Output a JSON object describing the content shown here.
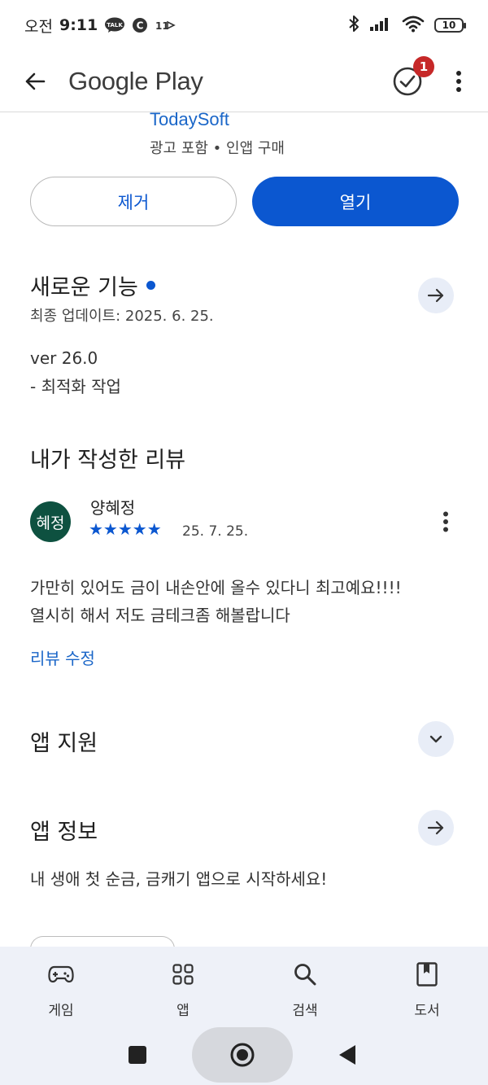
{
  "status_bar": {
    "time_prefix": "오전",
    "time": "9:11",
    "notif_talk": "TALK",
    "notif_c": "C",
    "notif_11": "11",
    "battery": "10"
  },
  "app_bar": {
    "title": "Google Play",
    "badge_count": "1"
  },
  "app": {
    "developer": "TodaySoft",
    "meta": "광고 포함 • 인앱 구매"
  },
  "actions": {
    "uninstall_label": "제거",
    "open_label": "열기"
  },
  "whats_new": {
    "title": "새로운 기능",
    "last_updated": "최종 업데이트: 2025. 6. 25.",
    "version": "ver 26.0",
    "notes": "- 최적화 작업"
  },
  "my_review": {
    "title": "내가 작성한 리뷰",
    "avatar_text": "혜정",
    "reviewer": "양혜정",
    "stars": "★★★★★",
    "rating": 5,
    "date": "25. 7. 25.",
    "text_line1": "가만히 있어도 금이 내손안에 올수 있다니 최고예요!!!!",
    "text_line2": "열시히 해서 저도 금테크좀 해볼랍니다",
    "edit_label": "리뷰 수정"
  },
  "app_support": {
    "title": "앱 지원"
  },
  "app_info": {
    "title": "앱 정보",
    "description": "내 생애 첫 순금, 금캐기 앱으로 시작하세요!"
  },
  "bottom_nav": {
    "items": [
      {
        "label": "게임",
        "icon": "gamepad-icon"
      },
      {
        "label": "앱",
        "icon": "apps-grid-icon"
      },
      {
        "label": "검색",
        "icon": "search-icon"
      },
      {
        "label": "도서",
        "icon": "book-icon"
      }
    ]
  },
  "colors": {
    "accent": "#0b57d0",
    "link": "#1a66c8",
    "avatar_bg": "#0e5140",
    "badge": "#c62828",
    "nav_bg": "#eef1f8"
  }
}
